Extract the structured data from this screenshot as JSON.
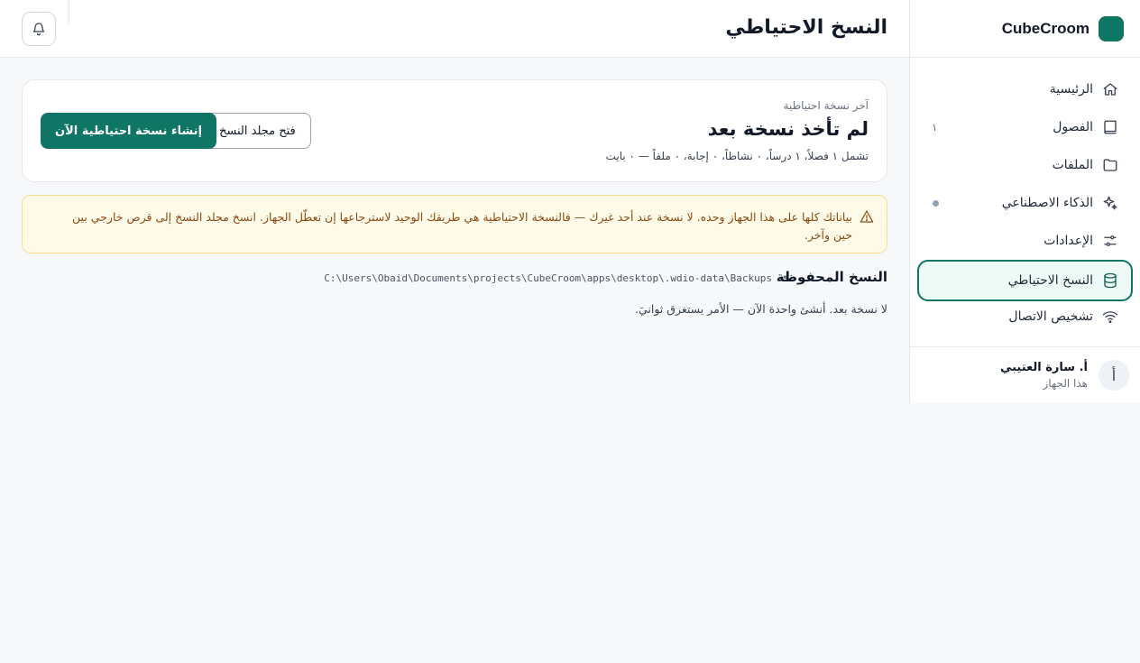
{
  "app": {
    "brand": "CubeCroom"
  },
  "sidebar": {
    "items": [
      {
        "label": "الرئيسية",
        "icon": "home-icon"
      },
      {
        "label": "الفصول",
        "icon": "book-icon",
        "badge": "١"
      },
      {
        "label": "الملفات",
        "icon": "folder-icon"
      },
      {
        "label": "الذكاء الاصطناعي",
        "icon": "sparkles-icon"
      },
      {
        "label": "الإعدادات",
        "icon": "sliders-icon"
      },
      {
        "label": "النسخ الاحتياطي",
        "icon": "database-icon",
        "active": true
      },
      {
        "label": "تشخيص الاتصال",
        "icon": "wifi-icon"
      }
    ],
    "user": {
      "avatar": "أ",
      "name": "أ. سارة العتيبي",
      "subtitle": "هذا الجهاز"
    }
  },
  "header": {
    "title": "النسخ الاحتياطي",
    "bell_icon": "bell-icon"
  },
  "backup_card": {
    "eyebrow": "آخر نسخة احتياطية",
    "heading": "لم تأخذ نسخة بعد",
    "meta": "تشمل ١ فصلاً، ١ درساً، ٠ نشاطاً، ٠ إجابة، ٠ ملفاً — ٠ بايت",
    "primary_button": "إنشاء نسخة احتياطية الآن",
    "secondary_button": "فتح مجلد النسخ"
  },
  "alert": {
    "icon": "warning-icon",
    "text": "بياناتك كلها على هذا الجهاز وحده. لا نسخة عند أحد غيرك — فالنسخة الاحتياطية هي طريقك الوحيد لاسترجاعها إن تعطّل الجهاز. انسخ مجلد النسخ إلى قرص خارجي بين حين وآخر."
  },
  "saved": {
    "title": "النسخ المحفوظة",
    "separator": "•",
    "path": "C:\\Users\\Obaid\\Documents\\projects\\CubeCroom\\apps\\desktop\\.wdio-data\\Backups",
    "empty": "لا نسخة بعد. أنشئ واحدة الآن — الأمر يستغرق ثوانيَ."
  },
  "colors": {
    "accent": "#0f7565",
    "alert_bg": "#fefae8",
    "alert_text": "#8a4a12"
  }
}
